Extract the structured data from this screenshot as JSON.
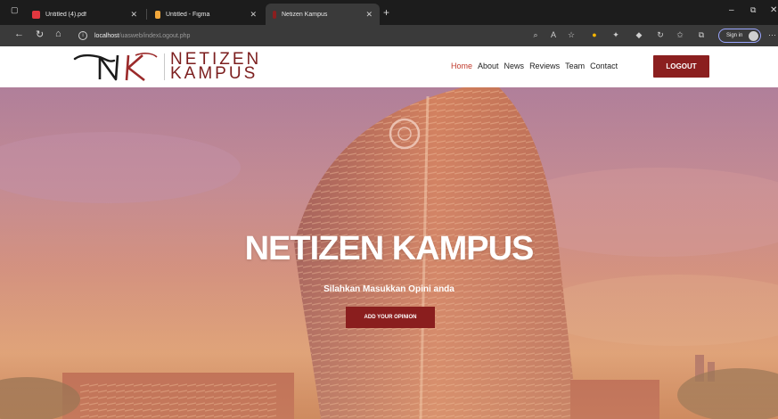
{
  "browser": {
    "tabs": [
      {
        "title": "Untitled (4).pdf",
        "icon": "pdf-icon",
        "color": "#e2373f"
      },
      {
        "title": "Untitled - Figma",
        "icon": "figma-icon",
        "color": "#f2a73b"
      },
      {
        "title": "Netizen Kampus",
        "icon": "site-icon",
        "color": "#8b1f1f"
      }
    ],
    "url_host": "localhost",
    "url_path": "/uasweb/indexLogout.php",
    "sign_in_label": "Sign in"
  },
  "site": {
    "logo_monogram": "NK",
    "logo_line1": "NETIZEN",
    "logo_line2": "KAMPUS",
    "nav": [
      "Home",
      "About",
      "News",
      "Reviews",
      "Team",
      "Contact"
    ],
    "logout_label": "LOGOUT",
    "accent_color": "#8b1f1f"
  },
  "hero": {
    "title": "NETIZEN KAMPUS",
    "subtitle": "Silahkan Masukkan Opini anda",
    "button_label": "ADD YOUR OPINION"
  }
}
